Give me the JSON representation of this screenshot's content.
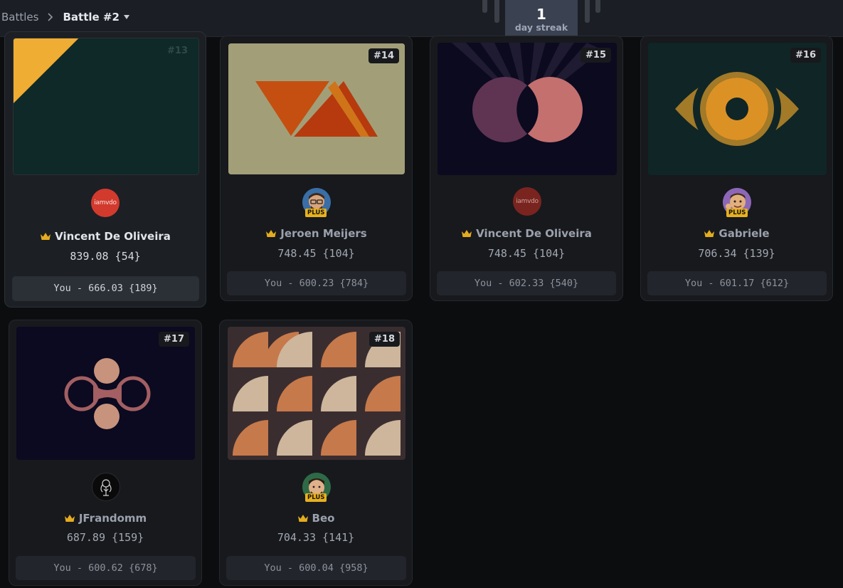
{
  "breadcrumb": {
    "root": "Battles",
    "current": "Battle #2"
  },
  "streak": {
    "count": "1",
    "label": "day streak"
  },
  "cards": [
    {
      "rank": "#13",
      "author": "Vincent De Oliveira",
      "avatar_text": "iamvdo",
      "score": "839.08 {54}",
      "you": "You - 666.03 {189}"
    },
    {
      "rank": "#14",
      "author": "Jeroen Meijers",
      "badge": "PLUS",
      "score": "748.45 {104}",
      "you": "You - 600.23 {784}"
    },
    {
      "rank": "#15",
      "author": "Vincent De Oliveira",
      "avatar_text": "iamvdo",
      "score": "748.45 {104}",
      "you": "You - 602.33 {540}"
    },
    {
      "rank": "#16",
      "author": "Gabriele",
      "badge": "PLUS",
      "score": "706.34 {139}",
      "you": "You - 601.17 {612}"
    },
    {
      "rank": "#17",
      "author": "JFrandomm",
      "score": "687.89 {159}",
      "you": "You - 600.62 {678}"
    },
    {
      "rank": "#18",
      "author": "Beo",
      "badge": "PLUS",
      "score": "704.33 {141}",
      "you": "You - 600.04 {958}"
    }
  ],
  "colors": {
    "crown": "#e5ac1f",
    "plus_badge": "#e6b120",
    "accent_dark": "#17191d"
  }
}
